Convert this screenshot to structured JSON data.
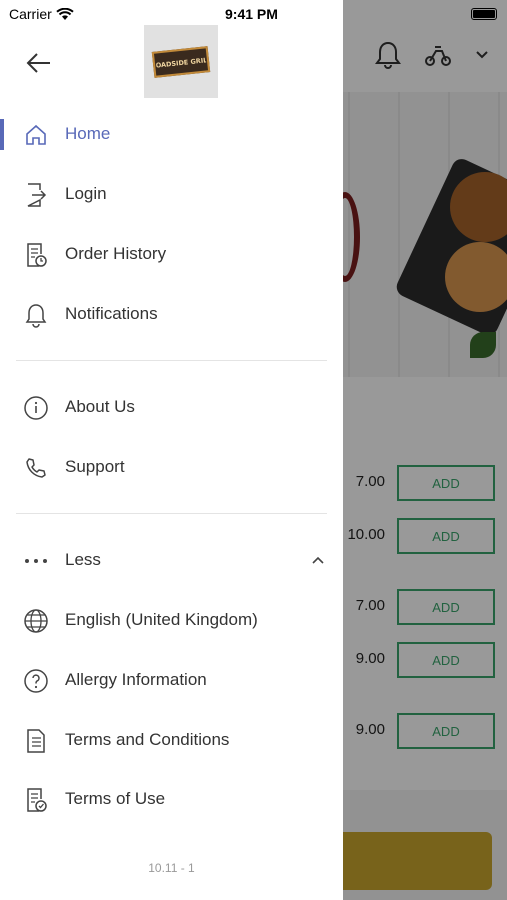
{
  "status_bar": {
    "carrier": "Carrier",
    "time": "9:41 PM"
  },
  "drawer": {
    "logo_text": "ROADSIDE GRILL",
    "menu": [
      {
        "label": "Home",
        "icon": "home-icon",
        "active": true
      },
      {
        "label": "Login",
        "icon": "login-icon"
      },
      {
        "label": "Order History",
        "icon": "order-history-icon"
      },
      {
        "label": "Notifications",
        "icon": "bell-icon"
      },
      {
        "label": "About Us",
        "icon": "info-icon"
      },
      {
        "label": "Support",
        "icon": "phone-icon"
      },
      {
        "label": "Less",
        "icon": "more-dots-icon"
      },
      {
        "label": "English (United Kingdom)",
        "icon": "globe-icon"
      },
      {
        "label": "Allergy Information",
        "icon": "question-icon"
      },
      {
        "label": "Terms and Conditions",
        "icon": "document-icon"
      },
      {
        "label": "Terms of Use",
        "icon": "document-check-icon"
      }
    ],
    "version": "10.11 - 1"
  },
  "background": {
    "rows": [
      {
        "price": "7.00",
        "button": "ADD"
      },
      {
        "price": "10.00",
        "button": "ADD"
      },
      {
        "price": "7.00",
        "button": "ADD"
      },
      {
        "price": "9.00",
        "button": "ADD"
      },
      {
        "price": "9.00",
        "button": "ADD"
      }
    ]
  },
  "colors": {
    "accent": "#5869b8",
    "add_green": "#3aa46b",
    "checkout": "#c8a52d"
  }
}
